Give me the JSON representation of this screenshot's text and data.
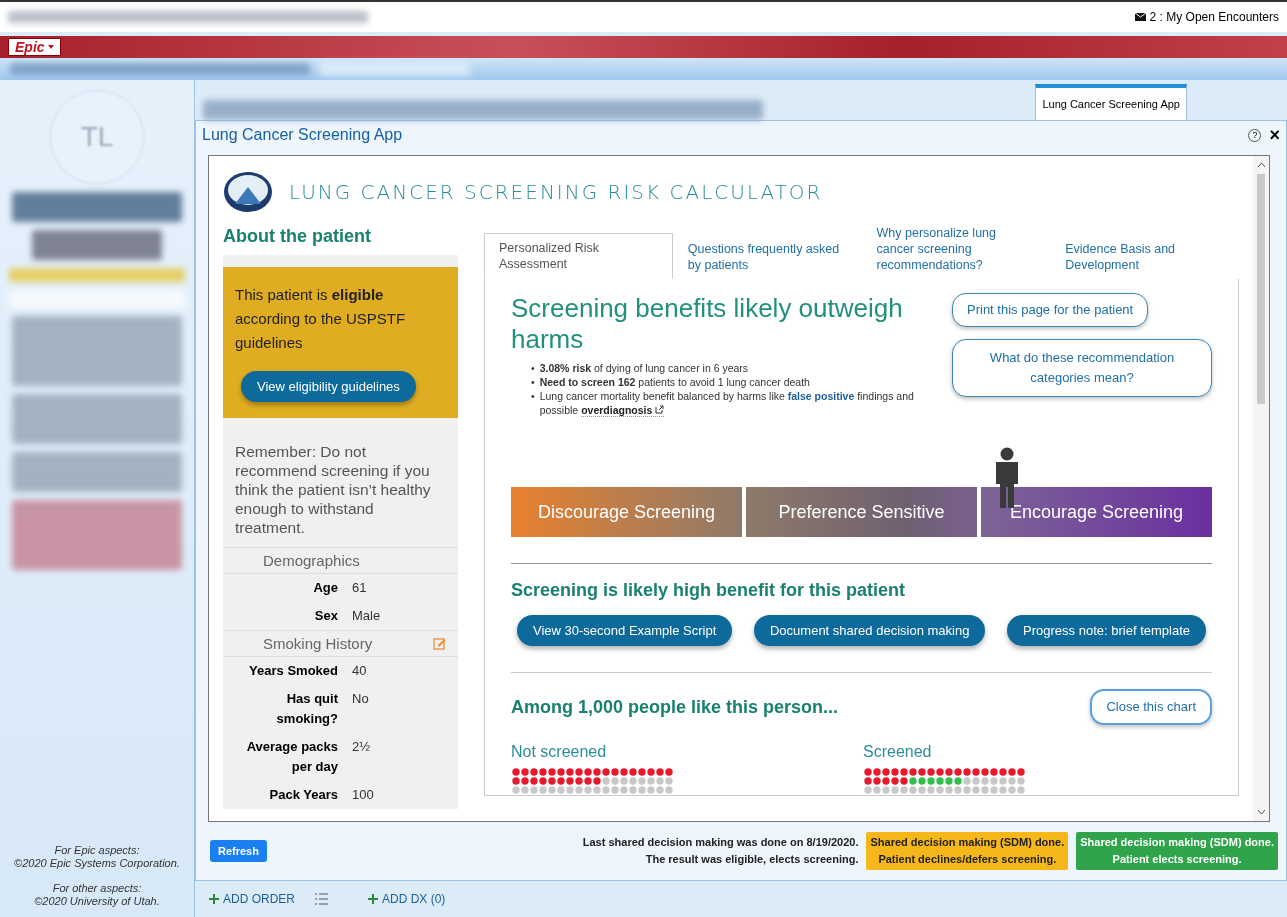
{
  "top_bar": {
    "encounters": "2 : My Open Encounters"
  },
  "epic_button": {
    "label": "Epic"
  },
  "sidebar": {
    "avatar_initials": "TL",
    "footer": [
      "For Epic aspects:",
      "©2020 Epic Systems Corporation.",
      "For other aspects:",
      "©2020 University of Utah."
    ]
  },
  "activity_tabs": [
    {
      "label": "Lung Cancer Screening App",
      "selected": true
    }
  ],
  "panel": {
    "title": "Lung Cancer Screening App",
    "help": "?",
    "close": "×"
  },
  "app": {
    "title": "LUNG CANCER SCREENING RISK CALCULATOR",
    "patient": {
      "heading": "About the patient",
      "eligibility": "This patient is **eligible** according to the USPSTF guidelines",
      "eligibility_button": "View eligibility guidelines",
      "reminder": "Remember: Do not recommend screening if you think the patient isn’t healthy enough to withstand treatment.",
      "sections": [
        {
          "title": "Demographics",
          "editable": false,
          "rows": [
            {
              "label": "Age",
              "value": "61"
            },
            {
              "label": "Sex",
              "value": "Male"
            }
          ]
        },
        {
          "title": "Smoking History",
          "editable": true,
          "rows": [
            {
              "label": "Years Smoked",
              "value": "40"
            },
            {
              "label": "Has quit smoking?",
              "value": "No"
            },
            {
              "label": "Average packs per day",
              "value": "2½"
            },
            {
              "label": "Pack Years",
              "value": "100"
            }
          ]
        }
      ]
    },
    "tabs": [
      {
        "label": "Personalized Risk Assessment",
        "selected": true
      },
      {
        "label": "Questions frequently asked by patients",
        "selected": false
      },
      {
        "label": "Why personalize lung cancer screening recommendations?",
        "selected": false
      },
      {
        "label": "Evidence Basis and Development",
        "selected": false
      }
    ],
    "headline": "Screening benefits likely outweigh harms",
    "bullets": [
      {
        "marker": "•",
        "parts": [
          {
            "kind": "text",
            "text": "**3.08% risk** of dying of lung cancer in 6 years"
          }
        ]
      },
      {
        "marker": "•",
        "parts": [
          {
            "kind": "text",
            "text": "**Need to screen 162** patients to avoid 1 lung cancer death"
          }
        ]
      },
      {
        "marker": "•",
        "parts": [
          {
            "kind": "text",
            "text": "Lung cancer mortality benefit balanced by harms like "
          },
          {
            "kind": "link",
            "text": "false positive"
          },
          {
            "kind": "text",
            "text": " findings and possible "
          },
          {
            "kind": "external",
            "text": "overdiagnosis"
          }
        ]
      }
    ],
    "side_buttons": [
      "Print this page for the patient",
      "What do these recommendation categories mean?"
    ],
    "spectrum": [
      {
        "label": "Discourage Screening",
        "selected": false
      },
      {
        "label": "Preference Sensitive",
        "selected": false
      },
      {
        "label": "Encourage Screening",
        "selected": true
      }
    ],
    "benefit": "Screening is likely high benefit for this patient",
    "action_buttons": [
      "View 30-second Example Script",
      "Document shared decision making",
      "Progress note: brief template"
    ],
    "among": "Among 1,000 people like this person...",
    "close_chart": "Close this chart",
    "groups": [
      {
        "label": "Not screened"
      },
      {
        "label": "Screened"
      }
    ]
  },
  "status": {
    "refresh": "Refresh",
    "last_sdm": [
      "Last shared decision making was done on 8/19/2020.",
      "The result was eligible, elects screening."
    ],
    "sdm_buttons": [
      {
        "lines": [
          "Shared decision making (SDM) done.",
          "Patient declines/defers screening."
        ],
        "color": "#f5b719"
      },
      {
        "lines": [
          "Shared decision making (SDM) done.",
          "Patient elects screening."
        ],
        "color": "#2fa44a"
      }
    ]
  },
  "actions": {
    "add_order": "ADD ORDER",
    "add_dx": "ADD DX (0)"
  }
}
